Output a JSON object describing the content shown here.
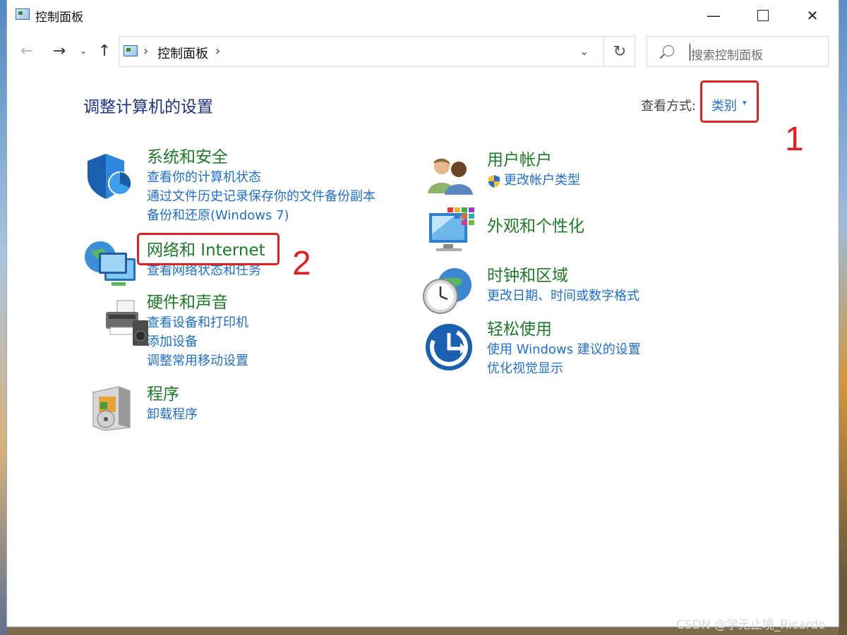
{
  "window": {
    "title": "控制面板",
    "minimize_glyph": "—",
    "close_glyph": "✕"
  },
  "nav": {
    "back_glyph": "←",
    "forward_glyph": "→",
    "recent_glyph": "⌄",
    "up_glyph": "↑",
    "address_crumb": "控制面板",
    "crumb_separator": "›",
    "dropdown_glyph": "⌄",
    "refresh_glyph": "↻",
    "search_placeholder": "搜索控制面板"
  },
  "content": {
    "heading": "调整计算机的设置",
    "view_by_label": "查看方式:",
    "view_by_value": "类别",
    "view_by_caret": "▾",
    "left_categories": [
      {
        "title": "系统和安全",
        "icon": "shield-icon",
        "links": [
          "查看你的计算机状态",
          "通过文件历史记录保存你的文件备份副本",
          "备份和还原(Windows 7)"
        ]
      },
      {
        "title": "网络和 Internet",
        "icon": "network-icon",
        "links": [
          "查看网络状态和任务"
        ]
      },
      {
        "title": "硬件和声音",
        "icon": "printer-icon",
        "links": [
          "查看设备和打印机",
          "添加设备",
          "调整常用移动设置"
        ]
      },
      {
        "title": "程序",
        "icon": "programs-icon",
        "links": [
          "卸载程序"
        ]
      }
    ],
    "right_categories": [
      {
        "title": "用户帐户",
        "icon": "users-icon",
        "links": [
          "更改帐户类型"
        ]
      },
      {
        "title": "外观和个性化",
        "icon": "appearance-icon",
        "links": []
      },
      {
        "title": "时钟和区域",
        "icon": "clock-globe-icon",
        "links": [
          "更改日期、时间或数字格式"
        ]
      },
      {
        "title": "轻松使用",
        "icon": "ease-of-access-icon",
        "links": [
          "使用 Windows 建议的设置",
          "优化视觉显示"
        ]
      }
    ]
  },
  "annotations": {
    "label_1": "1",
    "label_2": "2",
    "color": "#e02020"
  },
  "watermark": "CSDN @学无止境_Ricardo"
}
